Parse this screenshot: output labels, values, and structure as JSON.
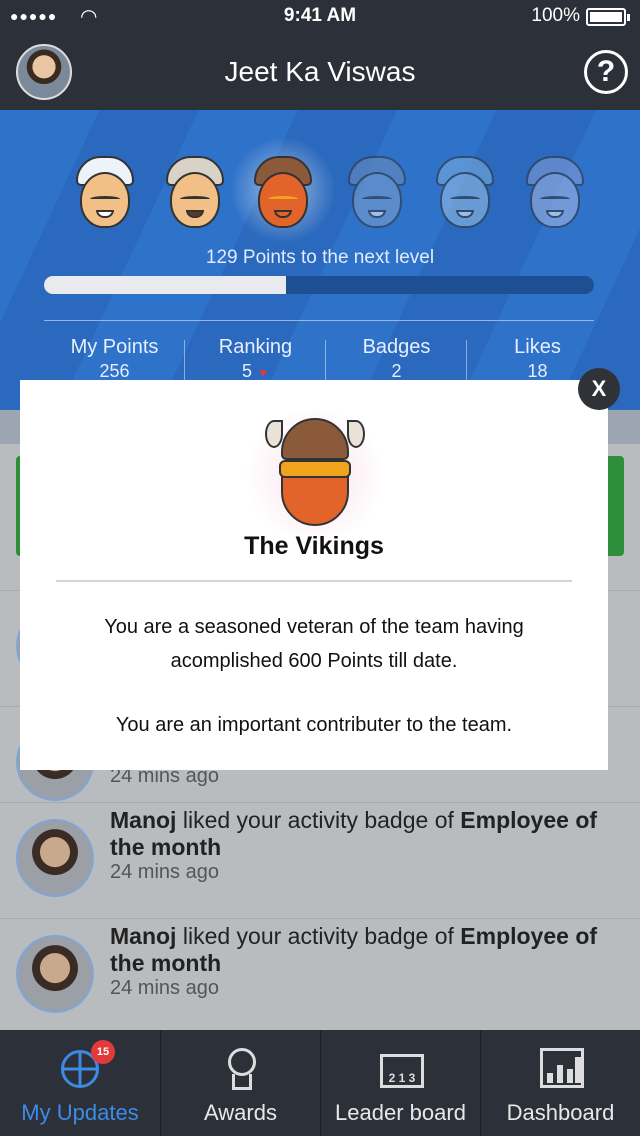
{
  "status_bar": {
    "signal": "●●●●●",
    "time": "9:41 AM",
    "battery": "100%"
  },
  "header": {
    "title": "Jeet Ka Viswas",
    "help_icon": "?"
  },
  "profile": {
    "levels": [
      "level-1",
      "level-2",
      "the-vikings",
      "level-4",
      "level-5",
      "level-6"
    ],
    "current_level_index": 2,
    "points_next": "129 Points to the next level",
    "progress_fraction": 0.44,
    "stats": [
      {
        "label": "My Points",
        "value": "256"
      },
      {
        "label": "Ranking",
        "value": "5",
        "trend": "▼"
      },
      {
        "label": "Badges",
        "value": "2"
      },
      {
        "label": "Likes",
        "value": "18"
      }
    ]
  },
  "feed": {
    "items": [
      {
        "user": "Manoj",
        "action": "liked your activity badge of",
        "target": "Employee of the month",
        "time": "24 mins ago"
      },
      {
        "user": "Manoj",
        "action": "liked your activity badge of",
        "target": "Employee of the month",
        "time": "24 mins ago"
      },
      {
        "user": "Manoj",
        "action": "liked your activity badge of",
        "target": "Employee of the month",
        "time": "24 mins ago"
      }
    ]
  },
  "modal": {
    "title": "The Vikings",
    "body_line1": "You are a seasoned veteran of the team having acomplished 600 Points till date.",
    "body_line2": "You are an important contributer to the team.",
    "close_label": "X"
  },
  "nav": {
    "items": [
      {
        "label": "My Updates",
        "icon": "globe-icon",
        "badge": "15",
        "active": true
      },
      {
        "label": "Awards",
        "icon": "medal-icon"
      },
      {
        "label": "Leader board",
        "icon": "podium-icon",
        "icon_text": "2 1 3"
      },
      {
        "label": "Dashboard",
        "icon": "chart-icon"
      }
    ]
  },
  "colors": {
    "accent": "#3d8be6",
    "panel_blue": "#2f72c9",
    "dark": "#2c3039",
    "alert": "#e23a3a"
  }
}
